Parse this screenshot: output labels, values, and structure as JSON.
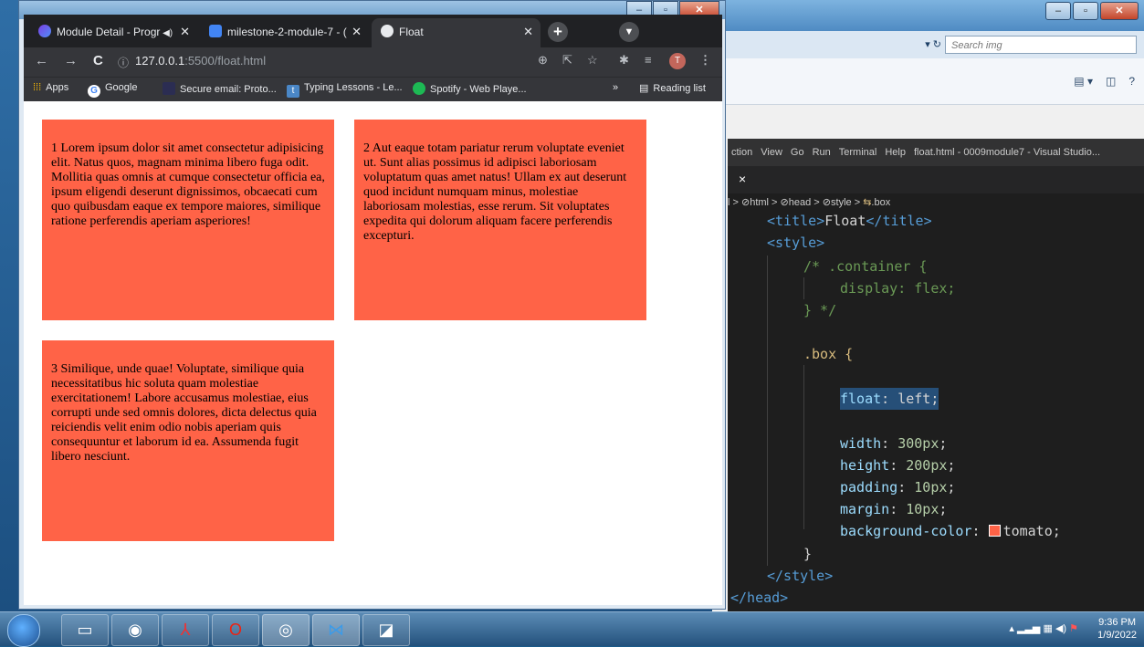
{
  "explorer": {
    "search_placeholder": "Search img",
    "nav_glyph": "▾  ↻"
  },
  "vscode": {
    "menu": [
      "ction",
      "View",
      "Go",
      "Run",
      "Terminal",
      "Help",
      "float.html - 0009module7 - Visual Studio..."
    ],
    "tab_close": "×",
    "breadcrumb": {
      "prefix": "l >",
      "html": "html",
      "head": "head",
      "style": "style",
      "box": ".box"
    },
    "code": {
      "l1_open": "<",
      "l1_tag": "title",
      "l1_close": ">",
      "l1_text": "Float",
      "l1_end_open": "</",
      "l1_end_tag": "title",
      "l1_end_close": ">",
      "l2": "<style>",
      "l3": "/* .container {",
      "l4": "display: flex;",
      "l5": "} */",
      "l6": ".box {",
      "l7_prop": "float",
      "l7_val": "left",
      "l8_prop": "width",
      "l8_val": "300px",
      "l9_prop": "height",
      "l9_val": "200px",
      "l10_prop": "padding",
      "l10_val": "10px",
      "l11_prop": "margin",
      "l11_val": "10px",
      "l12_prop": "background-color",
      "l12_val": "tomato",
      "l13": "}",
      "l14": "</style>",
      "l15": "</head>"
    },
    "swatch_color": "#ff6347"
  },
  "chrome": {
    "tabs": [
      {
        "title": "Module Detail - Progr",
        "icon_color": "#4f8ef7"
      },
      {
        "title": "milestone-2-module-7 - (",
        "icon_color": "#4285f4"
      },
      {
        "title": "Float",
        "icon_color": "#e8eaed"
      }
    ],
    "audio_glyph": "◀)",
    "url_host": "127.0.0.1",
    "url_rest": ":5500/float.html",
    "profile_initial": "T",
    "bookmarks": {
      "apps": "Apps",
      "google": "Google",
      "proton": "Secure email: Proto...",
      "typing": "Typing Lessons - Le...",
      "spotify": "Spotify - Web Playe...",
      "more": "»",
      "reading_list": "Reading list"
    }
  },
  "page": {
    "box1": "1 Lorem ipsum dolor sit amet consectetur adipisicing elit. Natus quos, magnam minima libero fuga odit. Mollitia quas omnis at cumque consectetur officia ea, ipsum eligendi deserunt dignissimos, obcaecati cum quo quibusdam eaque ex tempore maiores, similique ratione perferendis aperiam asperiores!",
    "box2": "2 Aut eaque totam pariatur rerum voluptate eveniet ut. Sunt alias possimus id adipisci laboriosam voluptatum quas amet natus! Ullam ex aut deserunt quod incidunt numquam minus, molestiae laboriosam molestias, esse rerum. Sit voluptates expedita qui dolorum aliquam facere perferendis excepturi.",
    "box3": "3 Similique, unde quae! Voluptate, similique quia necessitatibus hic soluta quam molestiae exercitationem! Labore accusamus molestiae, eius corrupti unde sed omnis dolores, dicta delectus quia reiciendis velit enim odio nobis aperiam quis consequuntur et laborum id ea. Assumenda fugit libero nesciunt.",
    "box_color": "tomato"
  },
  "taskbar": {
    "time": "9:36 PM",
    "date": "1/9/2022",
    "apps": [
      "file-explorer",
      "chrome",
      "acrobat",
      "opera",
      "chrome-canary",
      "vscode",
      "notes"
    ]
  }
}
